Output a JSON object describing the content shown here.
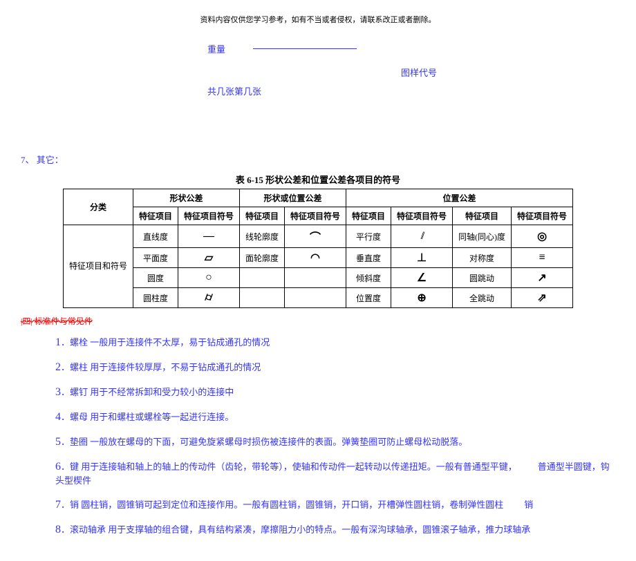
{
  "header": {
    "note": "资料内容仅供您学习参考，如有不当或者侵权，请联系改正或者删除。"
  },
  "title_block": {
    "weight_label": "重量",
    "drawing_code_label": "图样代号",
    "sheets_label": "共几张第几张"
  },
  "section7": {
    "label": "7、 其它："
  },
  "table": {
    "caption": "表 6-15   形状公差和位置公差各项目的符号",
    "head": {
      "c_category": "分类",
      "c_shape_tol": "形状公差",
      "c_shape_or_pos": "形状或位置公差",
      "c_pos_tol": "位置公差",
      "c_item": "特征项目",
      "c_item_sym": "特征项目符号"
    },
    "row_label": "特征项目和符号",
    "rows": [
      {
        "a": "直线度",
        "asym": "—",
        "b": "线轮廓度",
        "bsym": "⌒",
        "c": "平行度",
        "csym": "//",
        "d": "同轴(同心)度",
        "dsym": "◎"
      },
      {
        "a": "平面度",
        "asym": "▱",
        "b": "面轮廓度",
        "bsym": "◠",
        "c": "垂直度",
        "csym": "⊥",
        "d": "对称度",
        "dsym": "≡"
      },
      {
        "a": "圆度",
        "asym": "○",
        "b": "",
        "bsym": "",
        "c": "倾斜度",
        "csym": "∠",
        "d": "圆跳动",
        "dsym": "↗"
      },
      {
        "a": "圆柱度",
        "asym": "⌭",
        "b": "",
        "bsym": "",
        "c": "位置度",
        "csym": "⊕",
        "d": "全跳动",
        "dsym": "⇗"
      }
    ]
  },
  "section4": {
    "label": "|四|  标准件与常见件"
  },
  "list": [
    {
      "n": "1",
      "text": "螺栓 一般用于连接件不太厚，易于钻成通孔的情况"
    },
    {
      "n": "2",
      "text": "螺柱 用于连接件较厚厚，不易于钻成通孔的情况"
    },
    {
      "n": "3",
      "text": "螺钉 用于不经常拆卸和受力较小的连接中"
    },
    {
      "n": "4",
      "text": "螺母  用于和螺柱或螺栓等一起进行连接。"
    },
    {
      "n": "5",
      "text": "垫圈 一般放在螺母的下面，可避免旋紧螺母时损伤被连接件的表面。弹簧垫圈可防止螺母松动脱落。"
    },
    {
      "n": "6",
      "text": "键 用于连接轴和轴上的轴上的传动件（齿轮，带轮等），使轴和传动件一起转动以传递扭矩。一般有普通型平键，",
      "trail": "普通型半圆键，钩头型楔件"
    },
    {
      "n": "7",
      "text": "销  圆柱销，圆锥销可起到定位和连接作用。一般有圆柱销，圆锥销，开口销，开槽弹性圆柱销，卷制弹性圆柱",
      "trail": "销"
    },
    {
      "n": "8",
      "text": "滚动轴承    用于支撑轴的组合键，具有结构紧凑，摩擦阻力小的特点。一般有深沟球轴承，圆锥滚子轴承，推力球轴承"
    }
  ]
}
